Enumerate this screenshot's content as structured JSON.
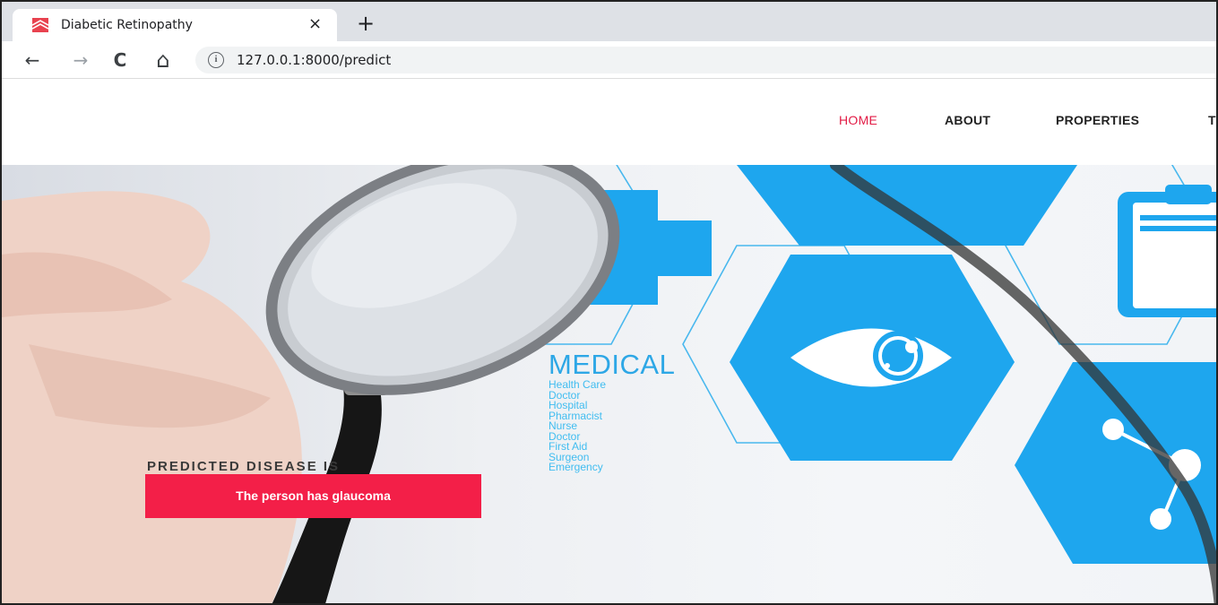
{
  "browser": {
    "tab_title": "Diabetic Retinopathy",
    "tab_close_glyph": "×",
    "new_tab_glyph": "+",
    "back_glyph": "←",
    "forward_glyph": "→",
    "reload_glyph": "C",
    "home_glyph": "⌂",
    "info_glyph": "i",
    "url": "127.0.0.1:8000/predict"
  },
  "nav": {
    "home": "HOME",
    "about": "ABOUT",
    "properties": "PROPERTIES",
    "cut_item": "T"
  },
  "hero": {
    "medical_title": "MEDICAL",
    "medical_items": [
      "Health Care",
      "Doctor",
      "Hospital",
      "Pharmacist",
      "Nurse",
      "Doctor",
      "First Aid",
      "Surgeon",
      "Emergency"
    ]
  },
  "prediction": {
    "label": "PREDICTED DISEASE IS",
    "result": "The person has glaucoma"
  },
  "colors": {
    "accent": "#f31f48",
    "nav_active": "#e21b45",
    "medical_blue": "#1ea6ee"
  }
}
